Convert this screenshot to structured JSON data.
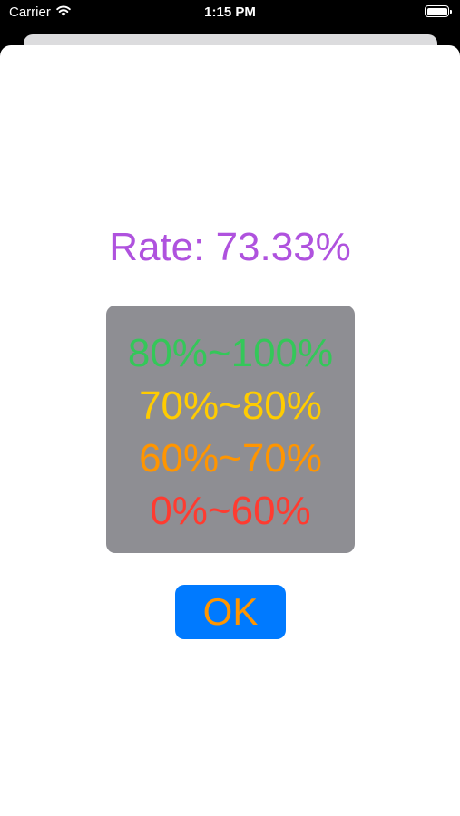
{
  "status_bar": {
    "carrier": "Carrier",
    "time": "1:15 PM",
    "icons": [
      "wifi-icon",
      "battery-icon"
    ]
  },
  "rate": {
    "label": "Rate: 73.33%",
    "color": "#af52de"
  },
  "legend": {
    "background": "#8e8e93",
    "items": [
      {
        "label": "80%~100%",
        "color": "#34c759"
      },
      {
        "label": "70%~80%",
        "color": "#ffcc00"
      },
      {
        "label": "60%~70%",
        "color": "#ff9500"
      },
      {
        "label": "0%~60%",
        "color": "#ff3b30"
      }
    ]
  },
  "ok_button": {
    "label": "OK",
    "background": "#007aff",
    "text_color": "#ff9500"
  }
}
